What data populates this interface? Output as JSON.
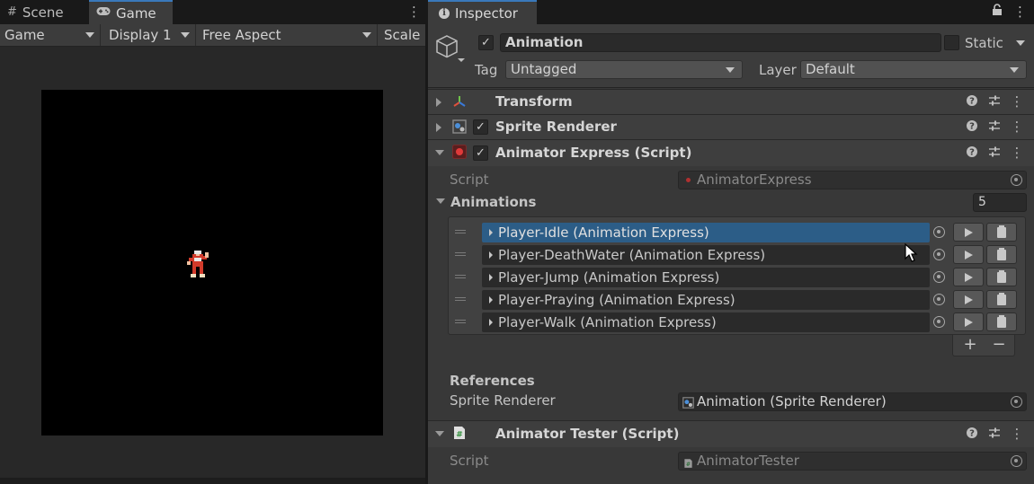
{
  "left_tabs": [
    {
      "label": "Scene",
      "icon": "grid-icon"
    },
    {
      "label": "Game",
      "icon": "gamepad-icon"
    }
  ],
  "game_toolbar": {
    "game": "Game",
    "display": "Display 1",
    "aspect": "Free Aspect",
    "scale": "Scale"
  },
  "inspector_tab": {
    "label": "Inspector"
  },
  "gameobject": {
    "name": "Animation",
    "static_label": "Static",
    "tag_label": "Tag",
    "tag_value": "Untagged",
    "layer_label": "Layer",
    "layer_value": "Default"
  },
  "components": {
    "transform": "Transform",
    "sprite_renderer": "Sprite Renderer",
    "animator_express": "Animator Express (Script)",
    "animator_tester": "Animator Tester (Script)"
  },
  "animator_express": {
    "script_label": "Script",
    "script_value": "AnimatorExpress",
    "animations_label": "Animations",
    "animations_count": "5",
    "animations": [
      "Player-Idle (Animation Express)",
      "Player-DeathWater (Animation Express)",
      "Player-Jump (Animation Express)",
      "Player-Praying (Animation Express)",
      "Player-Walk (Animation Express)"
    ],
    "references_label": "References",
    "sprite_renderer_label": "Sprite Renderer",
    "sprite_renderer_value": "Animation (Sprite Renderer)"
  },
  "animator_tester": {
    "script_label": "Script",
    "script_value": "AnimatorTester"
  },
  "list_buttons": {
    "add": "+",
    "remove": "−"
  },
  "colors": {
    "selection": "#2c5d87",
    "tab_accent": "#3a79bb",
    "panel_bg": "#383838"
  }
}
